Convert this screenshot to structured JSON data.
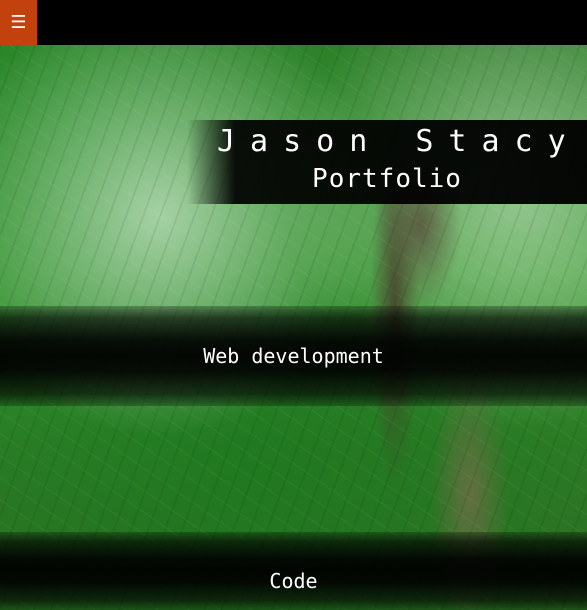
{
  "topbar": {
    "menu_icon": "☰"
  },
  "header": {
    "name": "Jason Stacy",
    "subtitle": "Portfolio"
  },
  "sections": [
    {
      "label": "Web development"
    },
    {
      "label": "Code"
    }
  ],
  "colors": {
    "menu_accent": "#c2410c",
    "topbar_bg": "#000000",
    "text": "#ffffff"
  }
}
